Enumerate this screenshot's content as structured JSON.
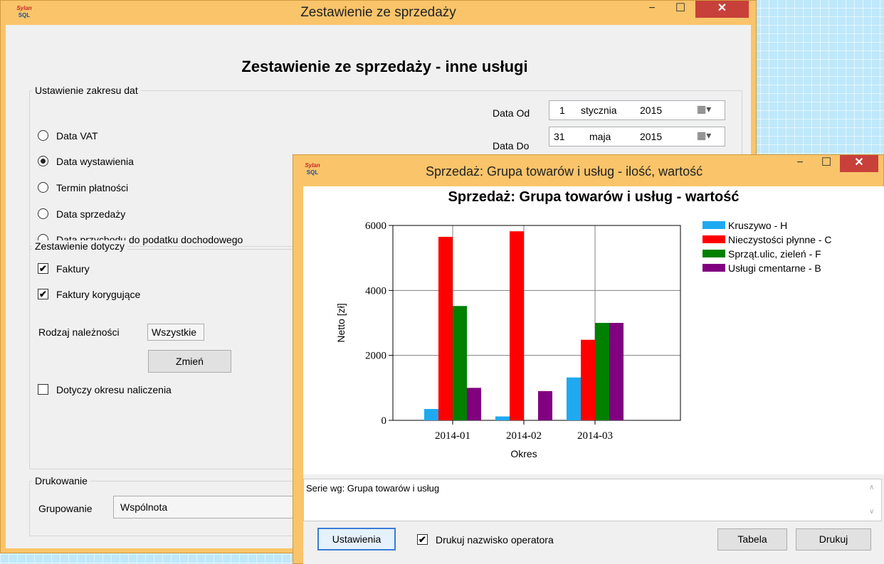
{
  "main_window": {
    "title": "Zestawienie ze sprzedaży",
    "icon": "app-logo-icon",
    "heading": "Zestawienie ze sprzedaży - inne usługi",
    "date_range_group": {
      "label": "Ustawienie zakresu dat",
      "options": [
        "Data VAT",
        "Data wystawienia",
        "Termin płatności",
        "Data sprzedaży",
        "Data przychodu do podatku dochodowego"
      ],
      "selected_index": 1
    },
    "date_from": {
      "label": "Data Od",
      "day": "1",
      "month": "stycznia",
      "year": "2015"
    },
    "date_to": {
      "label": "Data Do",
      "day": "31",
      "month": "maja",
      "year": "2015"
    },
    "scope_group": {
      "label": "Zestawienie dotyczy",
      "invoices_label": "Faktury",
      "invoices_checked": true,
      "corrections_label": "Faktury korygujące",
      "corrections_checked": true,
      "receivable_label": "Rodzaj należności",
      "receivable_value": "Wszystkie",
      "change_button": "Zmień",
      "accrual_label": "Dotyczy okresu naliczenia",
      "accrual_checked": false
    },
    "print_group": {
      "label": "Drukowanie",
      "grouping_label": "Grupowanie",
      "grouping_value": "Wspólnota"
    }
  },
  "chart_window": {
    "title": "Sprzedaż: Grupa towarów i usług - ilość, wartość",
    "icon": "app-logo-icon",
    "series_info": "Serie wg: Grupa towarów i usług",
    "settings_button": "Ustawienia",
    "print_operator_label": "Drukuj nazwisko operatora",
    "print_operator_checked": true,
    "table_button": "Tabela",
    "print_button": "Drukuj"
  },
  "chart_data": {
    "type": "bar",
    "title": "Sprzedaż: Grupa towarów i usług - wartość",
    "xlabel": "Okres",
    "ylabel": "Netto [zł]",
    "ylim": [
      0,
      6000
    ],
    "yticks": [
      0,
      2000,
      4000,
      6000
    ],
    "categories": [
      "2014-01",
      "2014-02",
      "2014-03"
    ],
    "grid": true,
    "legend_position": "right",
    "series": [
      {
        "name": "Kruszywo - H",
        "color": "#1eaaf0",
        "values": [
          350,
          120,
          1320
        ]
      },
      {
        "name": "Nieczystości płynne - C",
        "color": "#ff0000",
        "values": [
          5650,
          5820,
          2480
        ]
      },
      {
        "name": "Sprząt.ulic, zieleń - F",
        "color": "#008000",
        "values": [
          3520,
          0,
          3000
        ]
      },
      {
        "name": "Usługi cmentarne - B",
        "color": "#800080",
        "values": [
          1000,
          900,
          3000
        ]
      }
    ]
  }
}
